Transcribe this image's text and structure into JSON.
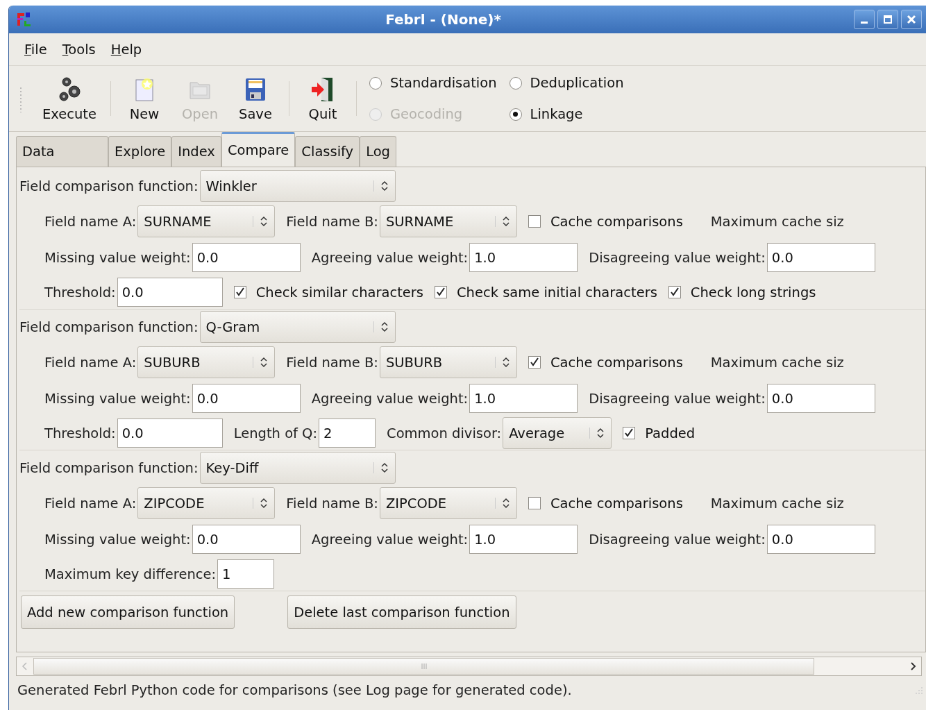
{
  "window": {
    "title": "Febrl - (None)*"
  },
  "menu": [
    "File",
    "Tools",
    "Help"
  ],
  "toolbar": [
    {
      "label": "Execute",
      "disabled": false
    },
    {
      "label": "New",
      "disabled": false
    },
    {
      "label": "Open",
      "disabled": true
    },
    {
      "label": "Save",
      "disabled": false
    },
    {
      "label": "Quit",
      "disabled": false
    }
  ],
  "modes": [
    {
      "label": "Standardisation",
      "selected": false,
      "disabled": false
    },
    {
      "label": "Deduplication",
      "selected": false,
      "disabled": false
    },
    {
      "label": "Geocoding",
      "selected": false,
      "disabled": true
    },
    {
      "label": "Linkage",
      "selected": true,
      "disabled": false
    }
  ],
  "tabs": [
    {
      "label": "Data",
      "selected": false
    },
    {
      "label": "Explore",
      "selected": false
    },
    {
      "label": "Index",
      "selected": false
    },
    {
      "label": "Compare",
      "selected": true
    },
    {
      "label": "Classify",
      "selected": false
    },
    {
      "label": "Log",
      "selected": false
    }
  ],
  "comparisons": [
    {
      "function_label": "Field comparison function:",
      "function": "Winkler",
      "field_a_label": "Field name A:",
      "field_a": "SURNAME",
      "field_b_label": "Field name B:",
      "field_b": "SURNAME",
      "cache": {
        "label": "Cache comparisons",
        "checked": false
      },
      "max_cache_label": "Maximum cache siz",
      "weights": [
        {
          "label": "Missing value weight:",
          "value": "0.0"
        },
        {
          "label": "Agreeing value weight:",
          "value": "1.0"
        },
        {
          "label": "Disagreeing value weight:",
          "value": "0.0"
        }
      ],
      "options": [
        {
          "kind": "input",
          "label": "Threshold:",
          "value": "0.0"
        },
        {
          "kind": "checkbox",
          "label": "Check similar characters",
          "checked": true
        },
        {
          "kind": "checkbox",
          "label": "Check same initial characters",
          "checked": true
        },
        {
          "kind": "checkbox",
          "label": "Check long strings",
          "checked": true
        }
      ]
    },
    {
      "function_label": "Field comparison function:",
      "function": "Q-Gram",
      "field_a_label": "Field name A:",
      "field_a": "SUBURB",
      "field_b_label": "Field name B:",
      "field_b": "SUBURB",
      "cache": {
        "label": "Cache comparisons",
        "checked": true
      },
      "max_cache_label": "Maximum cache siz",
      "weights": [
        {
          "label": "Missing value weight:",
          "value": "0.0"
        },
        {
          "label": "Agreeing value weight:",
          "value": "1.0"
        },
        {
          "label": "Disagreeing value weight:",
          "value": "0.0"
        }
      ],
      "options": [
        {
          "kind": "input",
          "label": "Threshold:",
          "value": "0.0"
        },
        {
          "kind": "input",
          "label": "Length of Q:",
          "value": "2"
        },
        {
          "kind": "select",
          "label": "Common divisor:",
          "value": "Average"
        },
        {
          "kind": "checkbox",
          "label": "Padded",
          "checked": true
        }
      ]
    },
    {
      "function_label": "Field comparison function:",
      "function": "Key-Diff",
      "field_a_label": "Field name A:",
      "field_a": "ZIPCODE",
      "field_b_label": "Field name B:",
      "field_b": "ZIPCODE",
      "cache": {
        "label": "Cache comparisons",
        "checked": false
      },
      "max_cache_label": "Maximum cache siz",
      "weights": [
        {
          "label": "Missing value weight:",
          "value": "0.0"
        },
        {
          "label": "Agreeing value weight:",
          "value": "1.0"
        },
        {
          "label": "Disagreeing value weight:",
          "value": "0.0"
        }
      ],
      "options": [
        {
          "kind": "input",
          "label": "Maximum key difference:",
          "value": "1"
        }
      ]
    }
  ],
  "buttons": [
    "Add new comparison function",
    "Delete last comparison function"
  ],
  "status_bar": "Generated Febrl Python code for comparisons (see Log page for generated code)."
}
